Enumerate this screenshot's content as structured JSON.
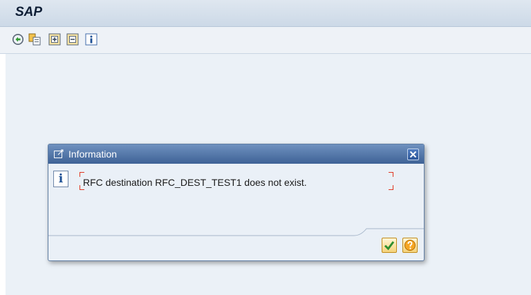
{
  "app": {
    "title": "SAP"
  },
  "toolbar": {
    "icons": [
      "execute-icon",
      "copy-icon",
      "expand-icon",
      "collapse-icon",
      "info-icon"
    ]
  },
  "dialog": {
    "title": "Information",
    "message": "RFC destination RFC_DEST_TEST1 does not exist.",
    "buttons": [
      "continue-icon",
      "help-icon"
    ]
  },
  "colors": {
    "dialog_header": "#3e6296",
    "workarea": "#ebf1f7",
    "button_fill": "#f4d27a",
    "marker": "#e0331f"
  }
}
